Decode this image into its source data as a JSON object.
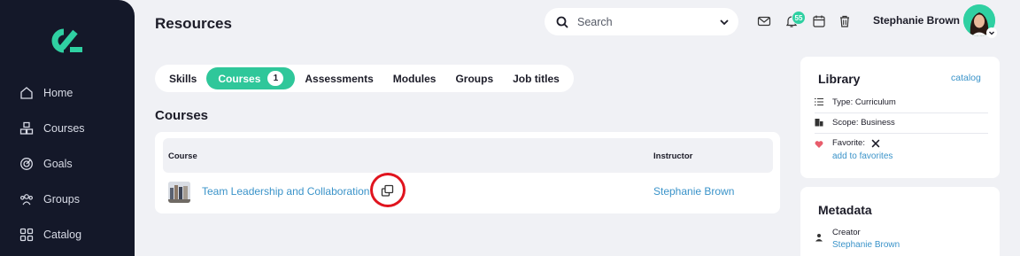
{
  "sidebar": {
    "items": [
      {
        "label": "Home",
        "icon": "home-icon"
      },
      {
        "label": "Courses",
        "icon": "courses-icon"
      },
      {
        "label": "Goals",
        "icon": "goals-icon"
      },
      {
        "label": "Groups",
        "icon": "groups-icon"
      },
      {
        "label": "Catalog",
        "icon": "catalog-icon"
      }
    ]
  },
  "header": {
    "title": "Resources",
    "search_placeholder": "Search",
    "notification_count": "55",
    "user_name": "Stephanie Brown"
  },
  "tabs": [
    {
      "label": "Skills"
    },
    {
      "label": "Courses",
      "count": "1",
      "active": true
    },
    {
      "label": "Assessments"
    },
    {
      "label": "Modules"
    },
    {
      "label": "Groups"
    },
    {
      "label": "Job titles"
    }
  ],
  "section_title": "Courses",
  "table": {
    "headers": [
      "Course",
      "Instructor"
    ],
    "rows": [
      {
        "course": "Team Leadership and Collaboration",
        "instructor": "Stephanie Brown"
      }
    ]
  },
  "library": {
    "title": "Library",
    "link": "catalog",
    "type": "Type: Curriculum",
    "scope": "Scope: Business",
    "favorite_label": "Favorite:",
    "add_favorites": "add to favorites"
  },
  "metadata": {
    "title": "Metadata",
    "creator_label": "Creator",
    "creator_name": "Stephanie Brown"
  },
  "colors": {
    "accent": "#2fc79a",
    "link": "#3a93c9",
    "sidebar": "#141829",
    "highlight": "#e0141e"
  }
}
